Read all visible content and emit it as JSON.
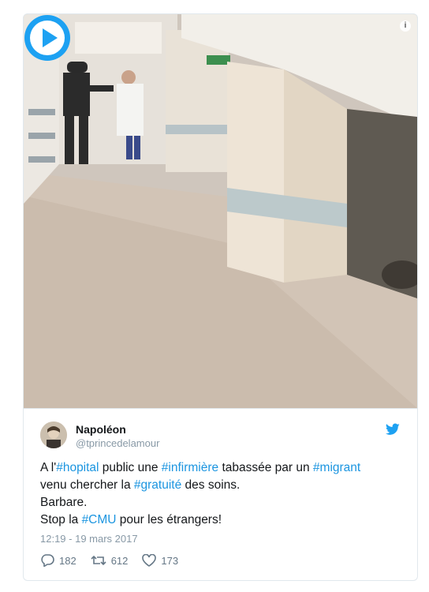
{
  "media": {
    "info_icon": "info-icon",
    "play_icon": "play-icon",
    "accent": "#1da1f2"
  },
  "tweet": {
    "author_name": "Napoléon",
    "author_handle": "@tprincedelamour",
    "text": {
      "l1_a": "A l'",
      "l1_tag1": "#hopital",
      "l1_b": " public une ",
      "l1_tag2": "#infirmière",
      "l1_c": " tabassée par un ",
      "l1_tag3": "#migrant",
      "l2_a": "venu chercher la ",
      "l2_tag": "#gratuité",
      "l2_b": " des soins.",
      "l3": "Barbare.",
      "l4_a": "Stop la ",
      "l4_tag": "#CMU",
      "l4_b": " pour les étrangers!"
    },
    "timestamp": "12:19 - 19 mars 2017",
    "replies": "182",
    "retweets": "612",
    "likes": "173",
    "colors": {
      "hashtag": "#1b95e0",
      "muted": "#8899a6",
      "bird": "#1da1f2"
    }
  }
}
